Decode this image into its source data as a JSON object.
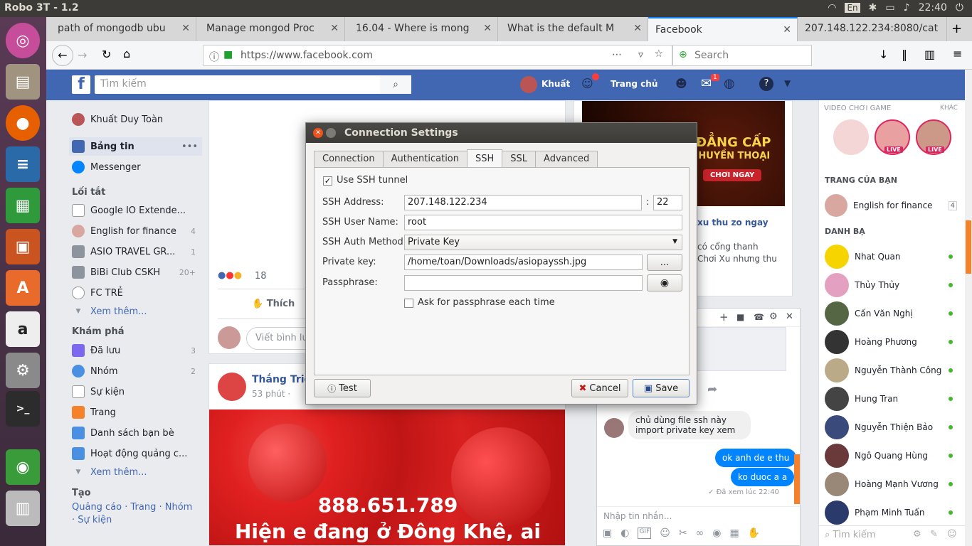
{
  "os": {
    "app_title": "Robo 3T - 1.2",
    "keyboard": "En",
    "clock": "22:40"
  },
  "launcher": {
    "icons": [
      "ubuntu-icon",
      "files-icon",
      "firefox-icon",
      "writer-icon",
      "calc-icon",
      "impress-icon",
      "software-center-icon",
      "amazon-icon",
      "settings-icon",
      "terminal-icon",
      "robo3t-icon",
      "trash-icon"
    ]
  },
  "browser": {
    "tabs": [
      {
        "label": "path of mongodb ubu"
      },
      {
        "label": "Manage mongod Proc"
      },
      {
        "label": "16.04 - Where is mong"
      },
      {
        "label": "What is the default M"
      },
      {
        "label": "Facebook"
      },
      {
        "label": "207.148.122.234:8080/cat"
      }
    ],
    "url": "https://www.facebook.com",
    "search_placeholder": "Search"
  },
  "facebook": {
    "search_placeholder": "Tìm kiếm",
    "user_name": "Khuất",
    "home": "Trang chủ",
    "notif_count": "1",
    "left": {
      "profile": "Khuất Duy Toàn",
      "news_feed": "Bảng tin",
      "messenger": "Messenger",
      "shortcuts_header": "Lối tắt",
      "shortcuts": [
        {
          "label": "Google IO Extende...",
          "count": ""
        },
        {
          "label": "English for finance",
          "count": "4"
        },
        {
          "label": "ASIO TRAVEL GR...",
          "count": "1"
        },
        {
          "label": "BiBi Club CSKH",
          "count": "20+"
        },
        {
          "label": "FC TRẺ",
          "count": ""
        }
      ],
      "see_more_1": "Xem thêm...",
      "explore_header": "Khám phá",
      "explore": [
        {
          "label": "Đã lưu",
          "count": "3"
        },
        {
          "label": "Nhóm",
          "count": "2"
        },
        {
          "label": "Sự kiện",
          "count": ""
        },
        {
          "label": "Trang",
          "count": ""
        },
        {
          "label": "Danh sách bạn bè",
          "count": ""
        },
        {
          "label": "Hoạt động quảng c...",
          "count": ""
        }
      ],
      "see_more_2": "Xem thêm...",
      "create_header": "Tạo",
      "create_links": "Quảng cáo · Trang · Nhóm · Sự kiện"
    },
    "post": {
      "reactions_count": "18",
      "like_label": "Thích",
      "comment_placeholder": "Viết bình luậ",
      "author2": "Thắng Triệ",
      "time2": "53 phút ·",
      "image_line1": "888.651.789",
      "image_line2": "Hiện e đang ở Đông Khê, ai"
    },
    "ad": {
      "banner_line1": "ĐẲNG CẤP",
      "banner_line2": "T HUYỀN THOẠI",
      "banner_cta": "CHƠI NGAY",
      "title": "xu thu zo ngay",
      "desc1": "có cổng thanh",
      "desc2": "Chơi Xu nhưng thu"
    },
    "right": {
      "video_header": "VIDEO CHƠI GAME",
      "video_more": "KHÁC",
      "live": "LIVE",
      "pages_header": "TRANG CỦA BẠN",
      "page_name": "English for finance",
      "page_count": "4",
      "contacts_header": "DANH BẠ",
      "contacts": [
        "Nhat Quan",
        "Thủy Thủy",
        "Cấn Văn Nghị",
        "Hoàng Phương",
        "Nguyễn Thành Công",
        "Hung Tran",
        "Nguyễn Thiện Bảo",
        "Ngô Quang Hùng",
        "Hoàng Mạnh Vương",
        "Phạm Minh Tuấn"
      ],
      "search_placeholder": "Tìm kiếm"
    },
    "chat": {
      "msg_in": "chủ dùng file ssh này import private key xem",
      "msg_out1": "ok anh de e thu",
      "msg_out2": "ko duoc a a",
      "seen": "Đã xem lúc 22:40",
      "input_placeholder": "Nhập tin nhắn..."
    }
  },
  "dialog": {
    "title": "Connection Settings",
    "tabs": [
      "Connection",
      "Authentication",
      "SSH",
      "SSL",
      "Advanced"
    ],
    "active_tab": "SSH",
    "use_ssh_label": "Use SSH tunnel",
    "use_ssh_checked": true,
    "address_label": "SSH Address:",
    "address_value": "207.148.122.234",
    "colon": ":",
    "port_value": "22",
    "user_label": "SSH User Name:",
    "user_value": "root",
    "auth_label": "SSH Auth Method:",
    "auth_value": "Private Key",
    "key_label": "Private key:",
    "key_value": "/home/toan/Downloads/asiopayssh.jpg",
    "browse_label": "...",
    "pass_label": "Passphrase:",
    "pass_value": "",
    "ask_label": "Ask for passphrase each time",
    "test_label": "Test",
    "cancel_label": "Cancel",
    "save_label": "Save"
  }
}
